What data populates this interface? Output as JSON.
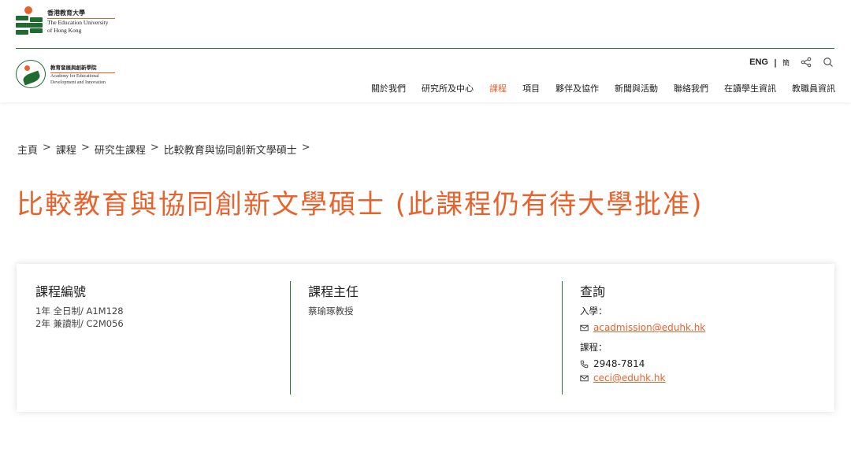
{
  "colors": {
    "accent": "#e8622c",
    "brand_green": "#1f6b30"
  },
  "header": {
    "university_logo": {
      "cn": "香港教育大學",
      "en_line1": "The Education University",
      "en_line2": "of Hong Kong"
    },
    "faculty_logo": {
      "cn": "教育發展與創新學院",
      "en_line1": "Academy for Educational",
      "en_line2": "Development and Innovation"
    },
    "utility": {
      "lang_en": "ENG",
      "separator": "|",
      "lang_simplified": "簡",
      "share_icon": "share-icon",
      "search_icon": "search-icon"
    },
    "nav": [
      {
        "label": "關於我們",
        "active": false
      },
      {
        "label": "研究所及中心",
        "active": false
      },
      {
        "label": "課程",
        "active": true
      },
      {
        "label": "項目",
        "active": false
      },
      {
        "label": "夥伴及協作",
        "active": false
      },
      {
        "label": "新聞與活動",
        "active": false
      },
      {
        "label": "聯絡我們",
        "active": false
      },
      {
        "label": "在讀學生資訊",
        "active": false
      },
      {
        "label": "教職員資訊",
        "active": false
      }
    ]
  },
  "breadcrumb": [
    "主頁",
    "課程",
    "研究生課程",
    "比較教育與協同創新文學碩士"
  ],
  "breadcrumb_sep": ">",
  "page_title": "比較教育與協同創新文學碩士 (此課程仍有待大學批准)",
  "info_card": {
    "code": {
      "heading": "課程編號",
      "lines": [
        "1年 全日制/ A1M128",
        "2年 兼讀制/ C2M056"
      ]
    },
    "director": {
      "heading": "課程主任",
      "name": "蔡瑜琢教授"
    },
    "enquiry": {
      "heading": "查詢",
      "admission_label": "入學：",
      "admission_email": "acadmission@eduhk.hk",
      "programme_label": "課程：",
      "programme_phone": "2948-7814",
      "programme_email": "ceci@eduhk.hk"
    }
  }
}
